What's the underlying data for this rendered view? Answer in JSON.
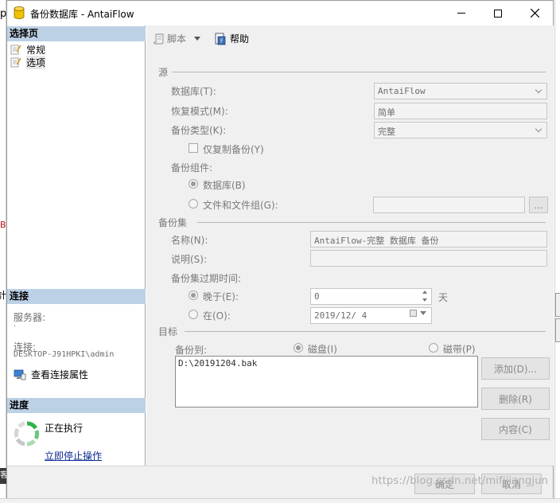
{
  "window": {
    "title": "备份数据库 - AntaiFlow",
    "minimize": "—",
    "maximize": "☐",
    "close": "✕"
  },
  "left": {
    "select_page_header": "选择页",
    "pages": [
      "常规",
      "选项"
    ],
    "connection_header": "连接",
    "server_label": "服务器:",
    "server_value": ".",
    "connection_label": "连接:",
    "connection_value": "DESKTOP-J91HPKI\\admin",
    "view_connection_props": "查看连接属性",
    "progress_header": "进度",
    "progress_status": "正在执行",
    "stop_now": "立即停止操作"
  },
  "toolbar": {
    "script": "脚本",
    "help": "帮助"
  },
  "source": {
    "title": "源",
    "database_label": "数据库(T):",
    "database_value": "AntaiFlow",
    "recovery_label": "恢复模式(M):",
    "recovery_value": "简单",
    "backup_type_label": "备份类型(K):",
    "backup_type_value": "完整",
    "copy_only_label": "仅复制备份(Y)",
    "component_label": "备份组件:",
    "component_db": "数据库(B)",
    "component_files": "文件和文件组(G):",
    "browse": "..."
  },
  "backup_set": {
    "title": "备份集",
    "name_label": "名称(N):",
    "name_value": "AntaiFlow-完整 数据库 备份",
    "desc_label": "说明(S):",
    "desc_value": "",
    "expire_label": "备份集过期时间:",
    "after_label": "晚于(E):",
    "after_value": "0",
    "after_unit": "天",
    "on_label": "在(O):",
    "on_value": "2019/12/ 4"
  },
  "destination": {
    "title": "目标",
    "backup_to_label": "备份到:",
    "disk": "磁盘(I)",
    "tape": "磁带(P)",
    "paths": [
      "D:\\20191204.bak"
    ],
    "add": "添加(D)...",
    "remove": "删除(R)",
    "contents": "内容(C)"
  },
  "footer": {
    "ok": "确定",
    "cancel": "取消",
    "watermark": "https://blog.csdn.net/mifijiangjun"
  },
  "background": {
    "frag_top": "op",
    "frag_mid": "計",
    "frag_b": "B",
    "frag_bottom": "客"
  }
}
